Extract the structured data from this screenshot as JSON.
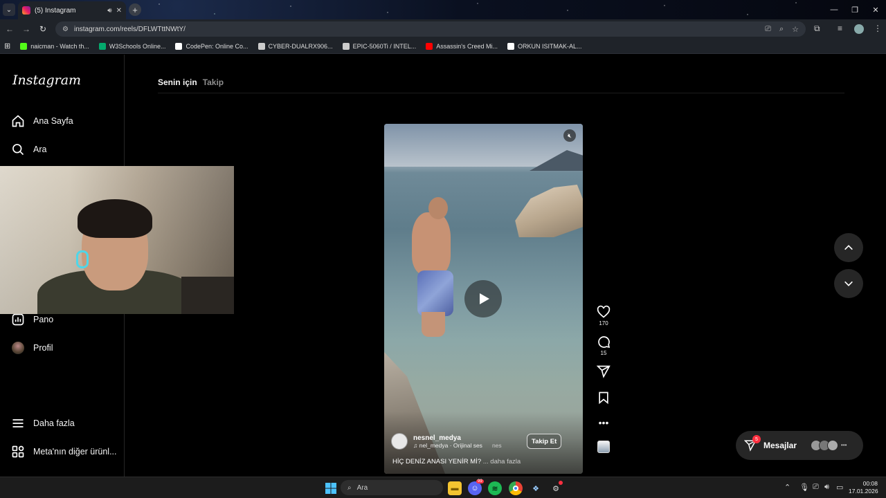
{
  "browser": {
    "tab_title": "(5) Instagram",
    "url": "instagram.com/reels/DFLWTttNWtY/",
    "bookmarks": [
      {
        "label": "naicman - Watch th...",
        "color": "#53fc18"
      },
      {
        "label": "W3Schools Online...",
        "color": "#04aa6d"
      },
      {
        "label": "CodePen: Online Co...",
        "color": "#ffffff"
      },
      {
        "label": "CYBER-DUALRX906...",
        "color": "#cccccc"
      },
      {
        "label": "EPIC-5060Ti / INTEL...",
        "color": "#cccccc"
      },
      {
        "label": "Assassin's Creed Mi...",
        "color": "#ff0000"
      },
      {
        "label": "ORKUN ISITMAK-AL...",
        "color": "#ffffff"
      }
    ]
  },
  "instagram": {
    "logo": "Instagram",
    "nav": {
      "home": "Ana Sayfa",
      "search": "Ara",
      "dashboard": "Pano",
      "profile": "Profil",
      "more": "Daha fazla",
      "meta": "Meta'nın diğer ürünl..."
    },
    "feed_tabs": {
      "for_you": "Senin için",
      "following": "Takip"
    },
    "reel": {
      "username": "nesnel_medya",
      "audio": "nel_medya · Orijinal ses",
      "audio_tail": "nes",
      "follow_label": "Takip Et",
      "caption": "HİÇ DENİZ ANASI YENİR Mİ?",
      "caption_more": "... daha fazla",
      "likes": "170",
      "comments": "15"
    },
    "messages": {
      "label": "Mesajlar",
      "badge": "5"
    }
  },
  "taskbar": {
    "search_placeholder": "Ara",
    "time": "00:08",
    "date": "17.01.2026",
    "discord_badge": "99"
  },
  "colors": {
    "accent_badge": "#ff3040",
    "background": "#000000",
    "panel": "#262626"
  }
}
